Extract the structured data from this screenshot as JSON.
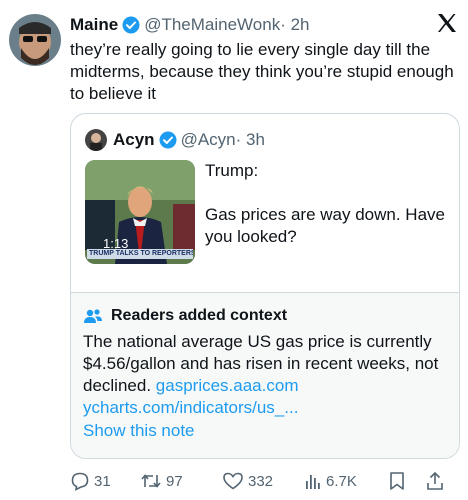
{
  "tweet": {
    "author_name": "Maine",
    "author_handle": "@TheMaineWonk",
    "time": "· 2h",
    "text": "they’re really going to lie every single day till the midterms, because they think you’re stupid enough to believe it"
  },
  "quote": {
    "author_name": "Acyn",
    "author_handle": "@Acyn",
    "time": "· 3h",
    "video_duration": "1:13",
    "video_chyron": "TRUMP TALKS TO REPORTERS",
    "line1": "Trump:",
    "line2": "Gas prices are way down. Have you looked?"
  },
  "context": {
    "heading": "Readers added context",
    "body": "The national average US gas price is currently $4.56/gallon and has risen in recent weeks, not declined.",
    "link1": "gasprices.aaa.com",
    "link2": "ycharts.com/indicators/us_...",
    "show_note": "Show this note"
  },
  "actions": {
    "replies": "31",
    "retweets": "97",
    "likes": "332",
    "views": "6.7K"
  },
  "colors": {
    "accent": "#1d9bf0",
    "muted": "#536471"
  }
}
